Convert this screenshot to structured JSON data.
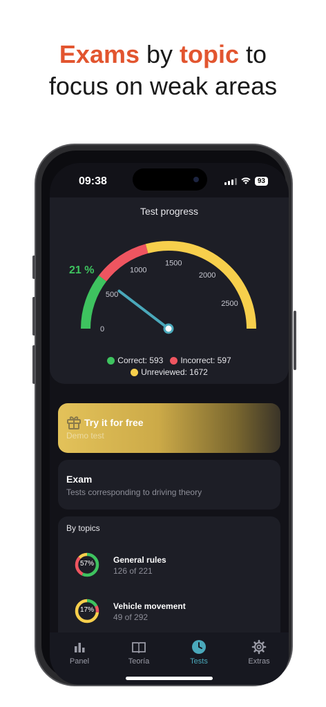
{
  "headline": {
    "line1_word1": "Exams",
    "line1_word2": " by ",
    "line1_word3": "topic",
    "line1_word4": " to",
    "line2": "focus on weak areas"
  },
  "status_bar": {
    "time": "09:38",
    "battery": "93"
  },
  "progress": {
    "title": "Test progress",
    "percent": "21 %",
    "ticks": [
      "0",
      "500",
      "1000",
      "1500",
      "2000",
      "2500"
    ],
    "needle_value": 593,
    "max_value": 2862,
    "legend": {
      "correct": "Correct: 593",
      "incorrect": "Incorrect: 597",
      "unreviewed": "Unreviewed: 1672"
    },
    "colors": {
      "correct": "#3ec35f",
      "incorrect": "#ef5560",
      "unreviewed": "#f7cf4c",
      "needle": "#4aa8ba"
    }
  },
  "demo": {
    "title": "Try it for free",
    "subtitle": "Demo test",
    "icon": "gift-icon"
  },
  "exam": {
    "title": "Exam",
    "subtitle": "Tests corresponding to driving theory"
  },
  "topics": {
    "title": "By topics",
    "items": [
      {
        "name": "General rules",
        "count": "126 of 221",
        "percent_label": "57%",
        "correct": 0.57,
        "incorrect": 0.3
      },
      {
        "name": "Vehicle movement",
        "count": "49 of 292",
        "percent_label": "17%",
        "correct": 0.17,
        "incorrect": 0.1
      }
    ]
  },
  "tabs": [
    {
      "label": "Panel",
      "icon": "bar-chart-icon"
    },
    {
      "label": "Teoría",
      "icon": "book-icon"
    },
    {
      "label": "Tests",
      "icon": "clock-icon",
      "active": true
    },
    {
      "label": "Extras",
      "icon": "gear-icon"
    }
  ]
}
